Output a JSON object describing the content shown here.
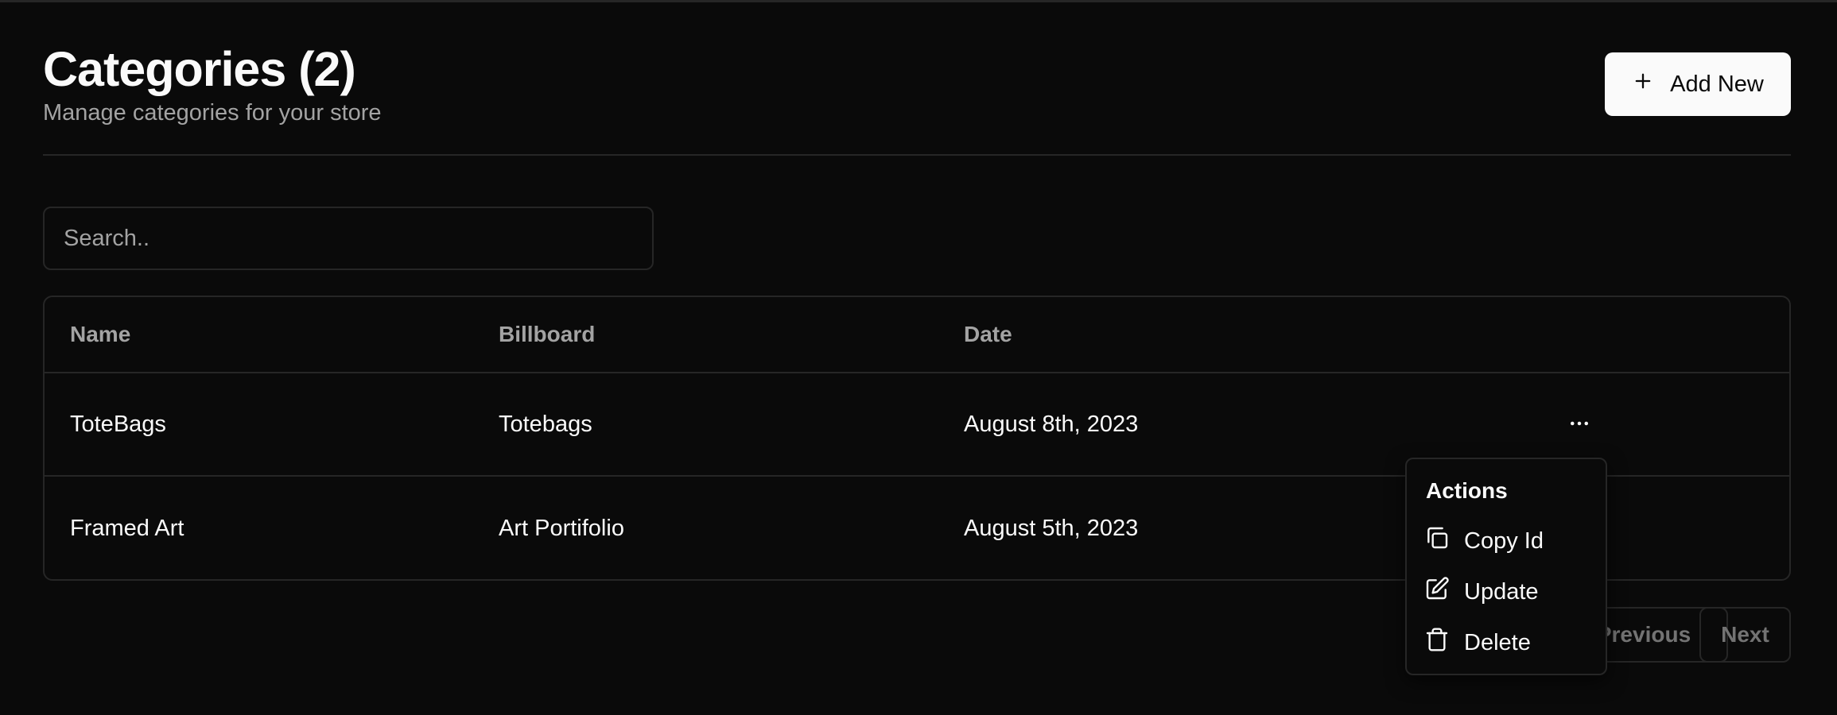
{
  "header": {
    "title": "Categories (2)",
    "subtitle": "Manage categories for your store",
    "add_button_label": "Add New",
    "add_icon": "plus-icon"
  },
  "search": {
    "placeholder": "Search..",
    "value": ""
  },
  "table": {
    "columns": [
      "Name",
      "Billboard",
      "Date"
    ],
    "rows": [
      {
        "name": "ToteBags",
        "billboard": "Totebags",
        "date": "August 8th, 2023"
      },
      {
        "name": "Framed Art",
        "billboard": "Art Portifolio",
        "date": "August 5th, 2023"
      }
    ],
    "row_menu_icon": "more-horizontal-icon"
  },
  "pagination": {
    "previous_label": "Previous",
    "next_label": "Next"
  },
  "actions_menu": {
    "label": "Actions",
    "items": [
      {
        "label": "Copy Id",
        "icon": "copy-icon"
      },
      {
        "label": "Update",
        "icon": "edit-icon"
      },
      {
        "label": "Delete",
        "icon": "trash-icon"
      }
    ]
  },
  "colors": {
    "background": "#0a0a0a",
    "border": "#262626",
    "foreground": "#fafafa",
    "muted": "#a3a3a3",
    "disabled": "#737373"
  }
}
